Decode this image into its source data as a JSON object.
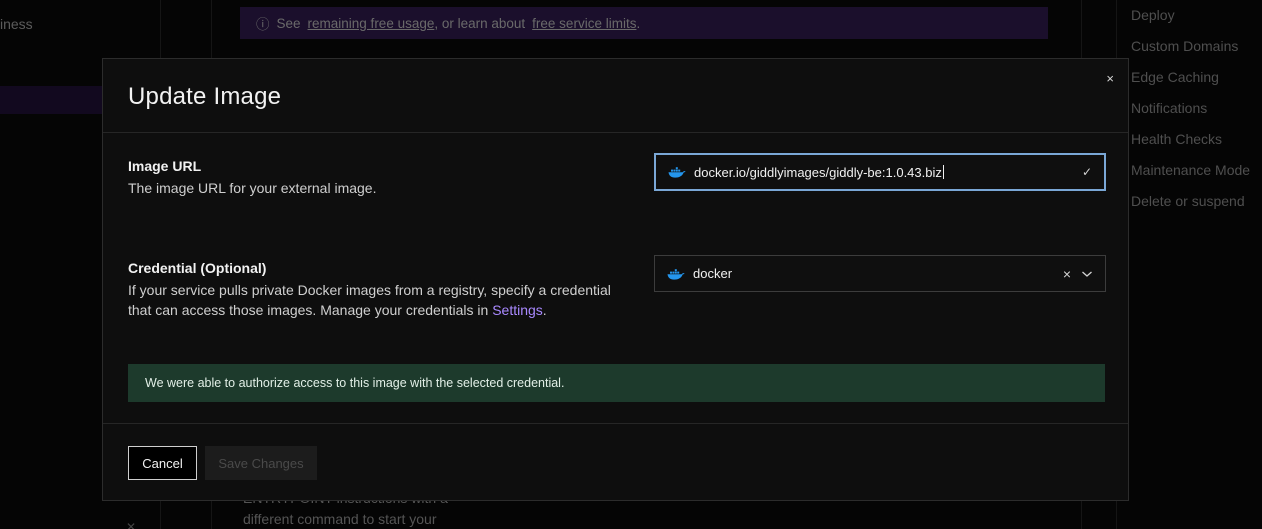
{
  "background": {
    "left_item": "iness",
    "banner": {
      "prefix": "See",
      "link1": "remaining free usage",
      "middle": ", or learn about",
      "link2": "free service limits",
      "suffix": "."
    },
    "right_nav": [
      "Deploy",
      "Custom Domains",
      "Edge Caching",
      "Notifications",
      "Health Checks",
      "Maintenance Mode",
      "Delete or suspend"
    ],
    "bottom_text_1": "ENTRYPOINT instructions with a",
    "bottom_text_2": "different command to start your"
  },
  "modal": {
    "title": "Update Image",
    "close_glyph": "×",
    "image_url": {
      "title": "Image URL",
      "description": "The image URL for your external image.",
      "value": "docker.io/giddlyimages/giddly-be:1.0.43.biz",
      "check_glyph": "✓"
    },
    "credential": {
      "title": "Credential (Optional)",
      "description": "If your service pulls private Docker images from a registry, specify a credential that can access those images. Manage your credentials in",
      "link": "Settings",
      "link_suffix": ".",
      "value": "docker",
      "clear_glyph": "×"
    },
    "success_message": "We were able to authorize access to this image with the selected credential.",
    "footer": {
      "cancel_label": "Cancel",
      "save_label": "Save Changes"
    }
  },
  "colors": {
    "accent_link": "#a989ff",
    "success_bg": "#1d3a2c",
    "focus_border": "#7aa7d6",
    "docker_blue": "#2496ed"
  }
}
